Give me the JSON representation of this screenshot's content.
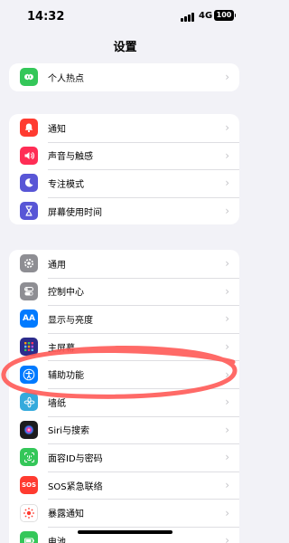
{
  "status_bar": {
    "time": "14:32",
    "network": "4G",
    "battery": "100"
  },
  "nav": {
    "title": "设置"
  },
  "group0": {
    "items": [
      {
        "label": "个人热点",
        "icon": "hotspot-icon",
        "color": "#34c759"
      }
    ]
  },
  "group1": {
    "items": [
      {
        "label": "通知",
        "icon": "bell-icon",
        "color": "#ff3b30"
      },
      {
        "label": "声音与触感",
        "icon": "speaker-icon",
        "color": "#ff2d55"
      },
      {
        "label": "专注模式",
        "icon": "moon-icon",
        "color": "#5856d6"
      },
      {
        "label": "屏幕使用时间",
        "icon": "hourglass-icon",
        "color": "#5856d6"
      }
    ]
  },
  "group2": {
    "items": [
      {
        "label": "通用",
        "icon": "gear-icon",
        "color": "#8e8e93"
      },
      {
        "label": "控制中心",
        "icon": "toggles-icon",
        "color": "#8e8e93"
      },
      {
        "label": "显示与亮度",
        "icon": "aa-icon",
        "color": "#007aff"
      },
      {
        "label": "主屏幕",
        "icon": "grid-icon",
        "color": "#2c2c8c"
      },
      {
        "label": "辅助功能",
        "icon": "accessibility-icon",
        "color": "#007aff"
      },
      {
        "label": "墙纸",
        "icon": "flower-icon",
        "color": "#34aadc"
      },
      {
        "label": "Siri与搜索",
        "icon": "siri-icon",
        "color": "#1c1c1e"
      },
      {
        "label": "面容ID与密码",
        "icon": "faceid-icon",
        "color": "#34c759"
      },
      {
        "label": "SOS紧急联络",
        "icon": "sos-icon",
        "color": "#ff3b30"
      },
      {
        "label": "暴露通知",
        "icon": "exposure-icon",
        "color": "#ffffff"
      },
      {
        "label": "电池",
        "icon": "battery-icon",
        "color": "#34c759"
      }
    ]
  },
  "icon_glyphs": {
    "aa": "AA",
    "sos": "SOS"
  },
  "chevron": "›"
}
